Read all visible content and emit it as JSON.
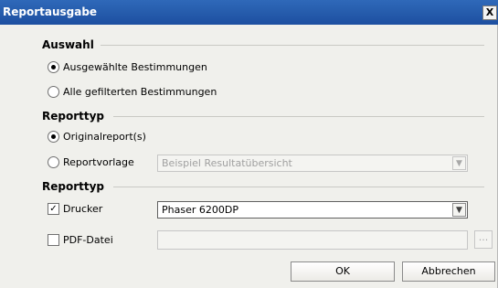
{
  "window": {
    "title": "Reportausgabe",
    "close_label": "X"
  },
  "auswahl": {
    "heading": "Auswahl",
    "options": [
      {
        "label": "Ausgewählte Bestimmungen",
        "selected": true
      },
      {
        "label": "Alle gefilterten Bestimmungen",
        "selected": false
      }
    ]
  },
  "reporttyp": {
    "heading": "Reporttyp",
    "original_label": "Originalreport(s)",
    "original_selected": true,
    "vorlage_label": "Reportvorlage",
    "vorlage_selected": false,
    "vorlage_value": "Beispiel Resultatübersicht"
  },
  "ausgabe": {
    "heading": "Reporttyp",
    "drucker_label": "Drucker",
    "drucker_checked": true,
    "drucker_value": "Phaser 6200DP",
    "pdf_label": "PDF-Datei",
    "pdf_checked": false,
    "pdf_value": "",
    "browse_label": "..."
  },
  "buttons": {
    "ok": "OK",
    "cancel": "Abbrechen"
  }
}
